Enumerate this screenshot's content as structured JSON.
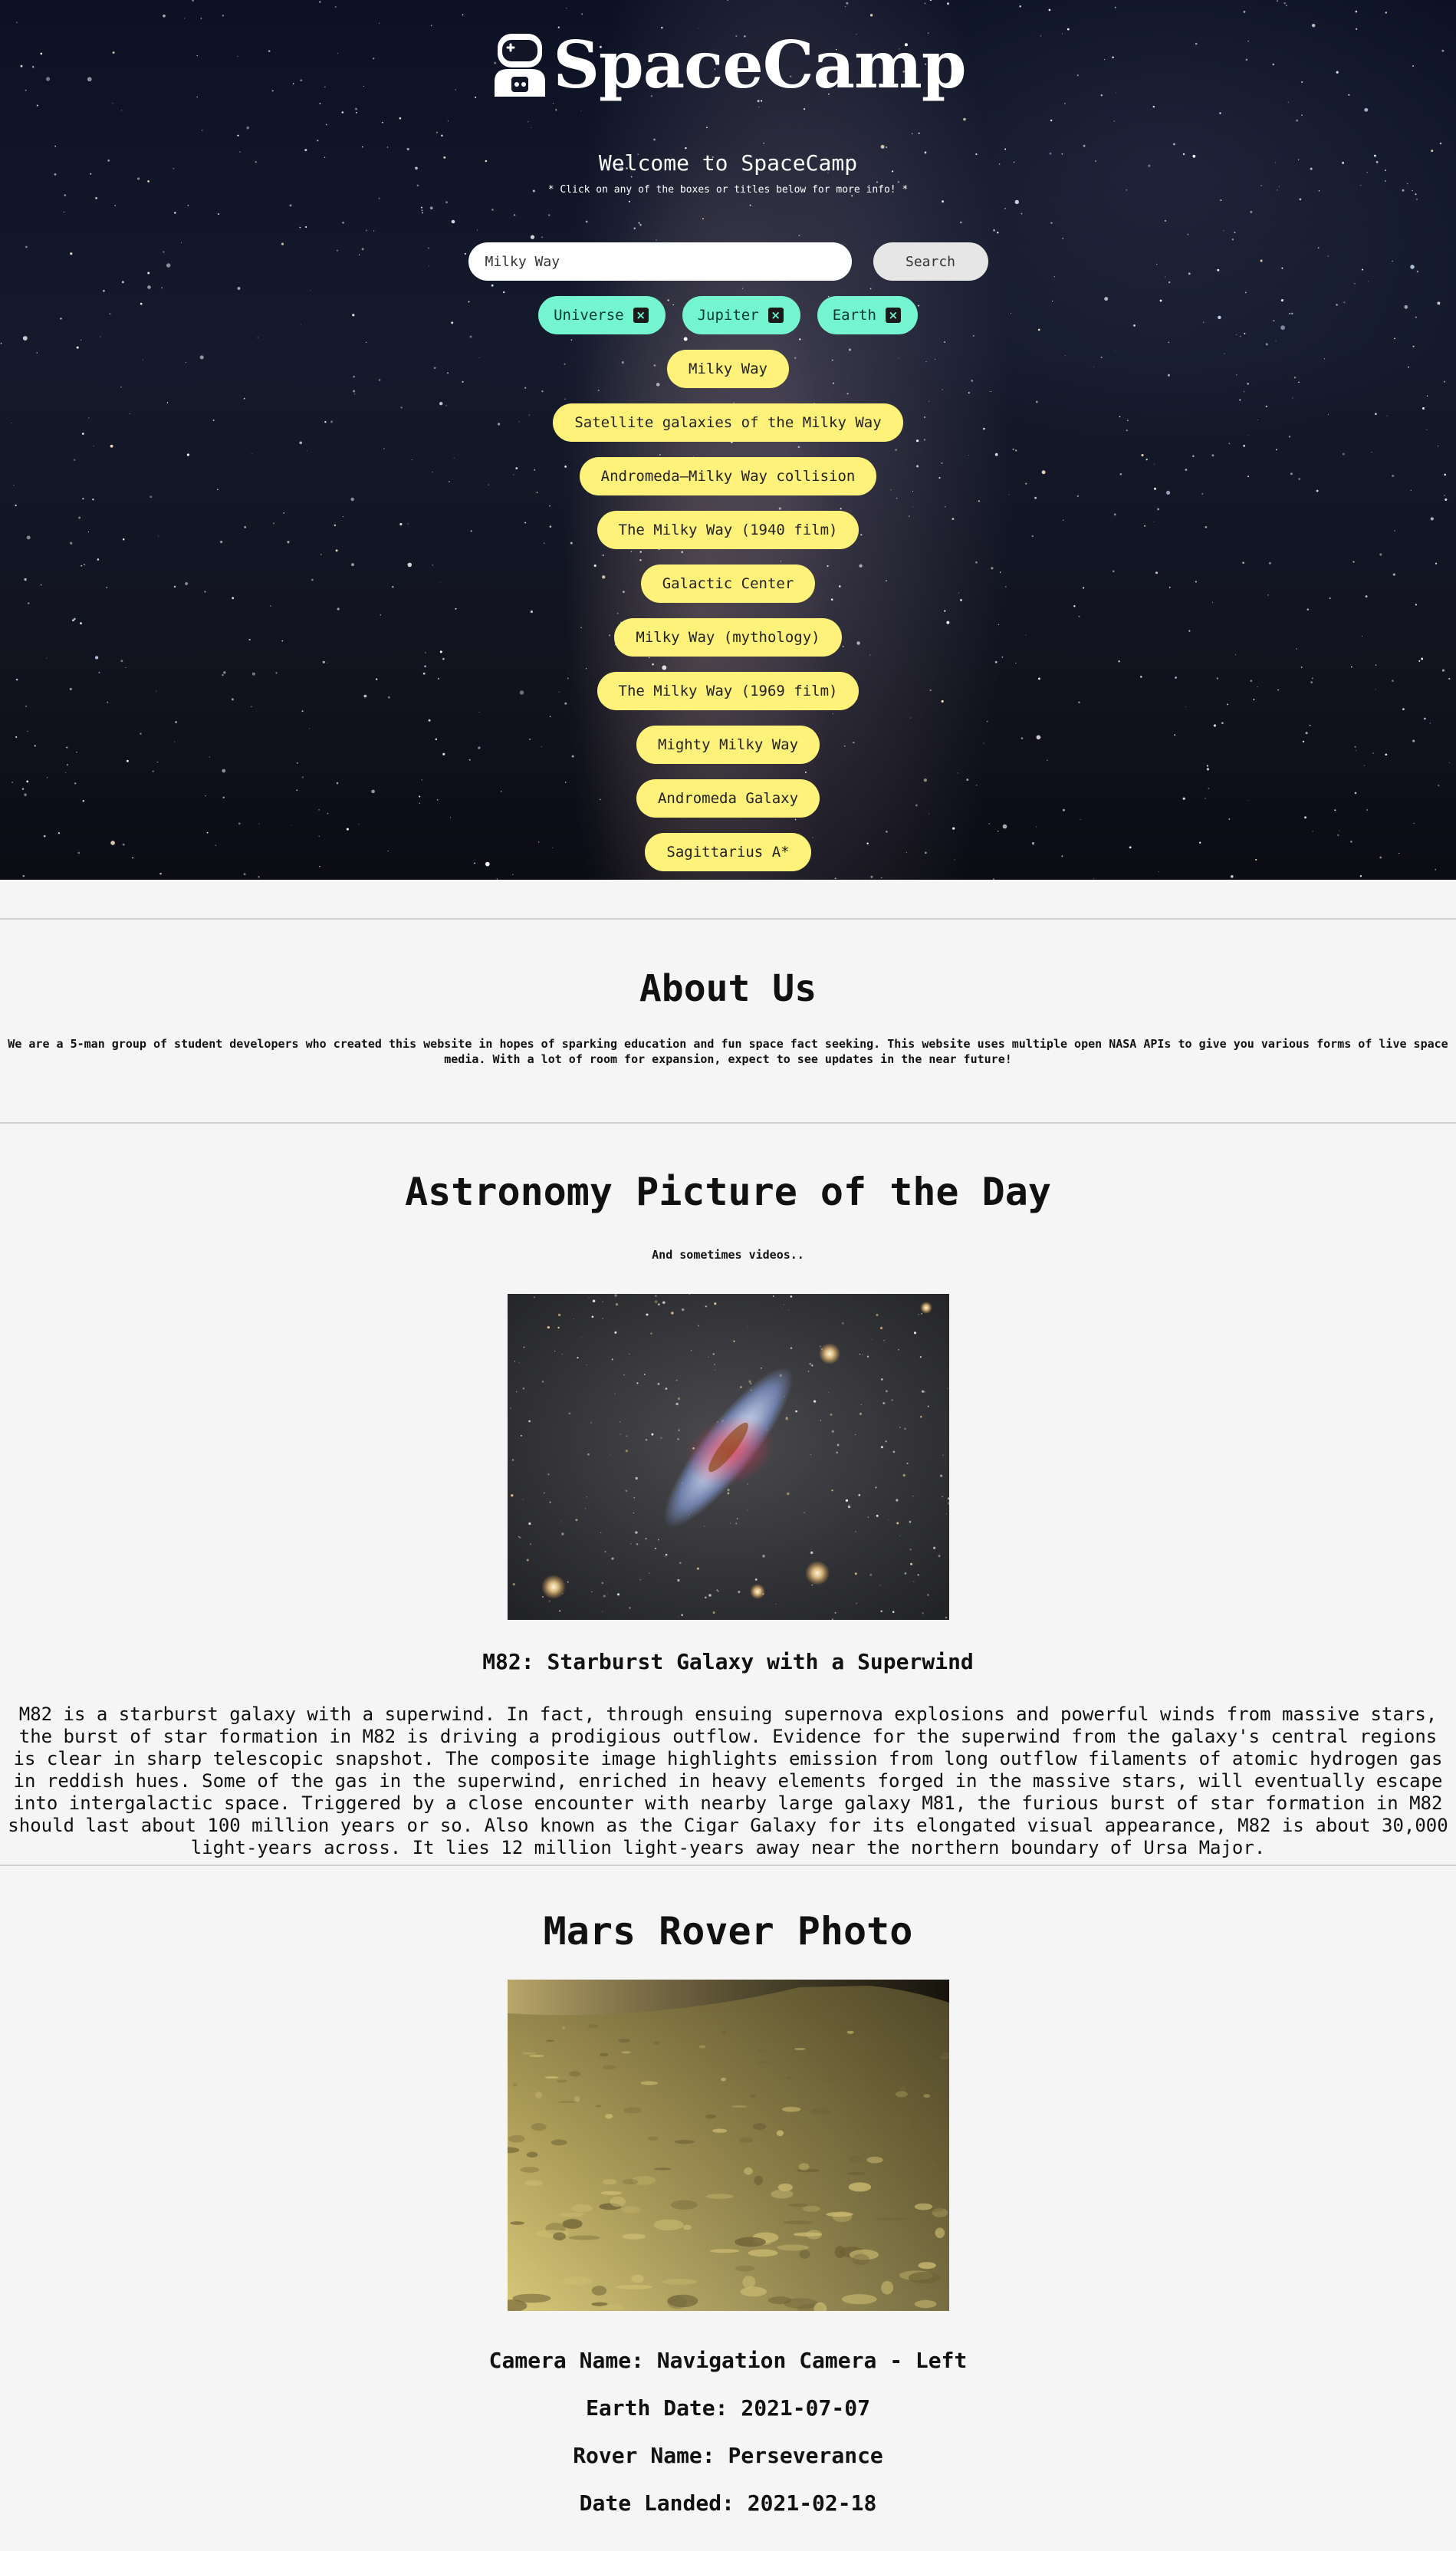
{
  "app": {
    "logo_text": "SpaceCamp",
    "welcome": "Welcome to SpaceCamp",
    "hint": "* Click on any of the boxes or titles below for more info! *"
  },
  "search": {
    "value": "Milky Way",
    "button_label": "Search"
  },
  "history": [
    {
      "label": "Universe",
      "close_icon": "x-square-icon"
    },
    {
      "label": "Jupiter",
      "close_icon": "x-square-icon"
    },
    {
      "label": "Earth",
      "close_icon": "x-square-icon"
    }
  ],
  "results": [
    "Milky Way",
    "Satellite galaxies of the Milky Way",
    "Andromeda–Milky Way collision",
    "The Milky Way (1940 film)",
    "Galactic Center",
    "Milky Way (mythology)",
    "The Milky Way (1969 film)",
    "Mighty Milky Way",
    "Andromeda Galaxy",
    "Sagittarius A*"
  ],
  "about": {
    "title": "About Us",
    "text_line1": "We are a 5-man group of student developers who created this website in hopes of sparking education and fun space fact seeking. This website uses multiple open NASA APIs to give you various forms of live space",
    "text_line2": "media. With a lot of room for expansion, expect to see updates in the near future!"
  },
  "apod": {
    "title": "Astronomy Picture of the Day",
    "subtitle": "And sometimes videos..",
    "image_title": "M82: Starburst Galaxy with a Superwind",
    "explanation": "M82 is a starburst galaxy with a superwind. In fact, through ensuing supernova explosions and powerful winds from massive stars, the burst of star formation in M82 is driving a prodigious outflow. Evidence for the superwind from the galaxy's central regions is clear in sharp telescopic snapshot. The composite image highlights emission from long outflow filaments of atomic hydrogen gas in reddish hues. Some of the gas in the superwind, enriched in heavy elements forged in the massive stars, will eventually escape into intergalactic space. Triggered by a close encounter with nearby large galaxy M81, the furious burst of star formation in M82 should last about 100 million years or so. Also known as the Cigar Galaxy for its elongated visual appearance, M82 is about 30,000 light-years across. It lies 12 million light-years away near the northern boundary of Ursa Major."
  },
  "mars": {
    "title": "Mars Rover Photo",
    "camera": "Camera Name: Navigation Camera - Left",
    "earth_date": "Earth Date: 2021-07-07",
    "rover": "Rover Name: Perseverance",
    "landed": "Date Landed: 2021-02-18"
  },
  "colors": {
    "history_chip": "#74f4cf",
    "result_chip": "#fff27a",
    "page_bg": "#f5f5f5"
  }
}
